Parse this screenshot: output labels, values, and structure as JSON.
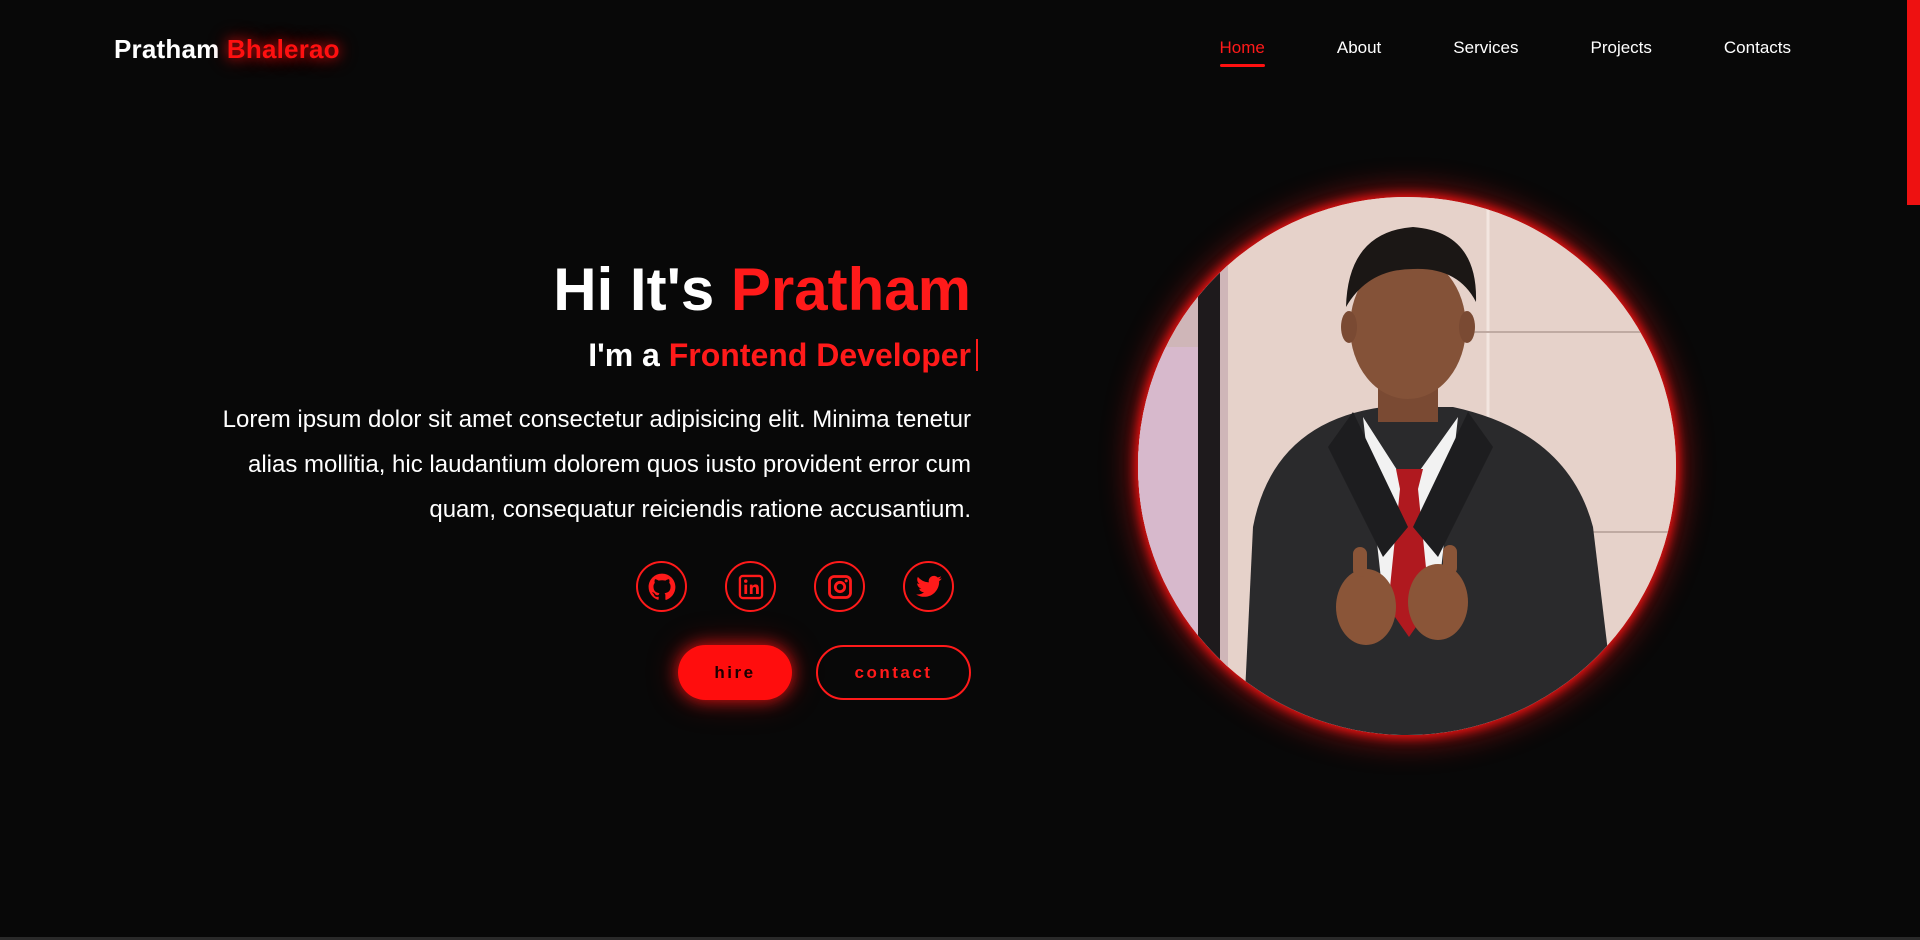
{
  "header": {
    "logo_first": "Pratham",
    "logo_last": "Bhalerao",
    "nav": [
      {
        "label": "Home",
        "active": true
      },
      {
        "label": "About",
        "active": false
      },
      {
        "label": "Services",
        "active": false
      },
      {
        "label": "Projects",
        "active": false
      },
      {
        "label": "Contacts",
        "active": false
      }
    ]
  },
  "hero": {
    "greeting_prefix": "Hi It's",
    "greeting_name": "Pratham",
    "role_prefix": "I'm a",
    "role_title": "Frontend Developer",
    "intro": "Lorem ipsum dolor sit amet consectetur adipisicing elit. Minima tenetur alias mollitia, hic laudantium dolorem quos iusto provident error cum quam, consequatur reiciendis ratione accusantium.",
    "socials": [
      {
        "icon": "github-icon"
      },
      {
        "icon": "linkedin-icon"
      },
      {
        "icon": "instagram-icon"
      },
      {
        "icon": "twitter-icon"
      }
    ],
    "hire_label": "hire",
    "contact_label": "contact"
  },
  "colors": {
    "accent": "#ff1a1a",
    "background": "#080808",
    "text": "#ffffff"
  }
}
